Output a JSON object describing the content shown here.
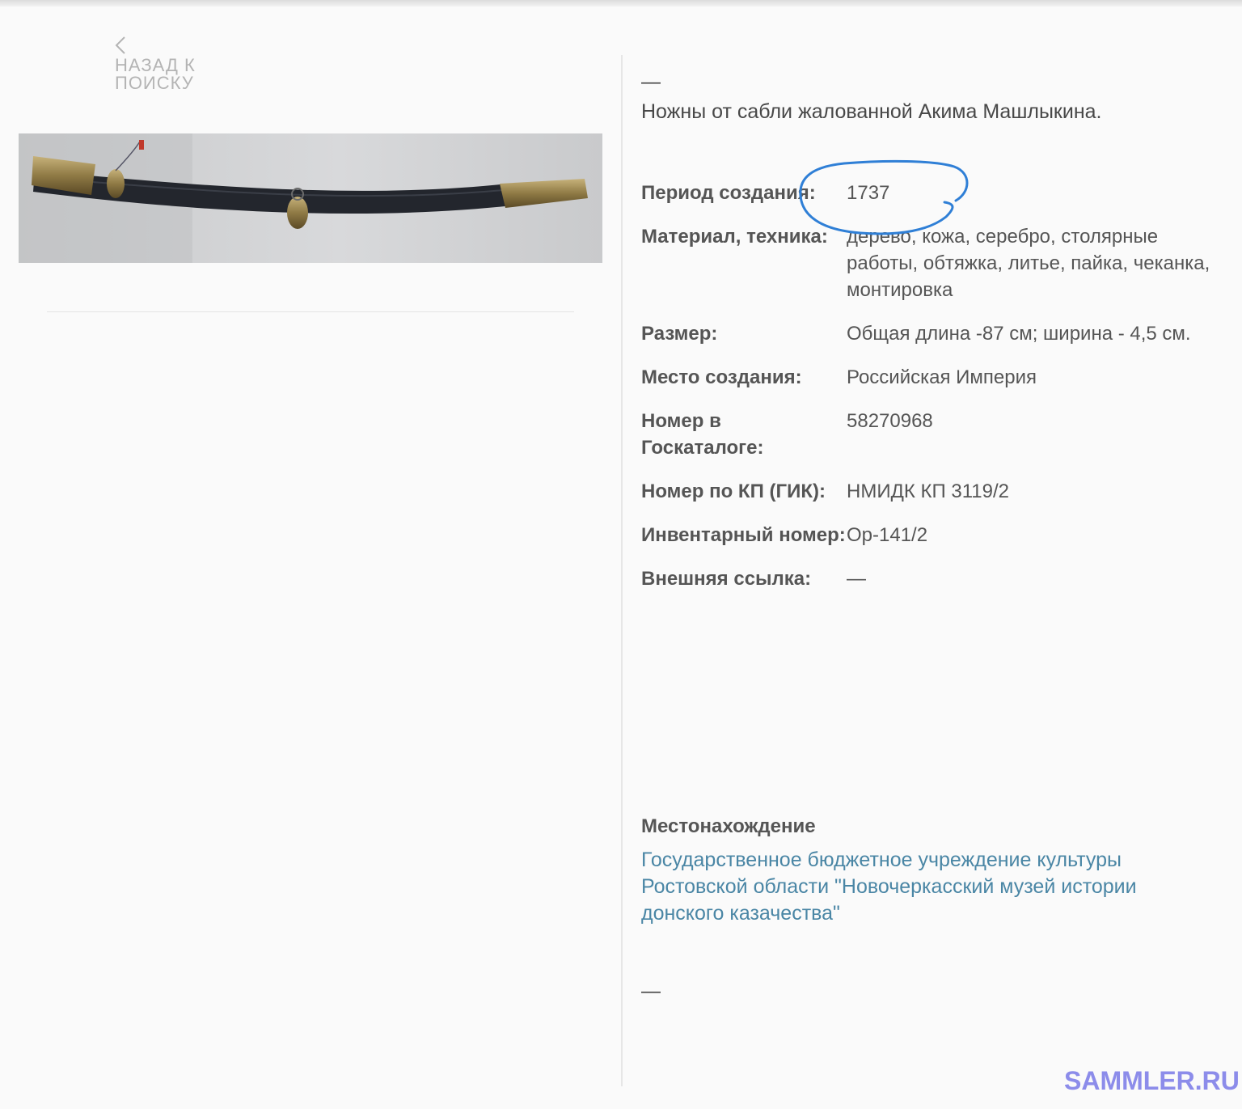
{
  "nav": {
    "back_label": "НАЗАД К ПОИСКУ"
  },
  "icons": {
    "back": "chevron-left-icon"
  },
  "object": {
    "dash": "—",
    "title": "Ножны от сабли жалованной Акима Машлыкина.",
    "properties": [
      {
        "label": "Период создания:",
        "value": "1737"
      },
      {
        "label": "Материал, техника:",
        "value": "дерево, кожа, серебро, столярные работы, обтяжка, литье, пайка, чеканка, монтировка"
      },
      {
        "label": "Размер:",
        "value": "Общая длина -87 см; ширина - 4,5 см."
      },
      {
        "label": "Место создания:",
        "value": "Российская Империя"
      },
      {
        "label": "Номер в Госкаталоге:",
        "value": "58270968"
      },
      {
        "label": "Номер по КП (ГИК):",
        "value": "НМИДК КП 3119/2"
      },
      {
        "label": "Инвентарный номер:",
        "value": "Ор-141/2"
      },
      {
        "label": "Внешняя ссылка:",
        "value": "—"
      }
    ],
    "location": {
      "heading": "Местонахождение",
      "link": "Государственное бюджетное учреждение культуры Ростовской области \"Новочеркасский музей истории донского казачества\""
    },
    "footer_dash": "—"
  },
  "annotation_color": "#2f7fd6",
  "link_color": "#4a86a5",
  "watermark": {
    "text": "SAMMLER.RU",
    "color": "#8c8cea"
  }
}
